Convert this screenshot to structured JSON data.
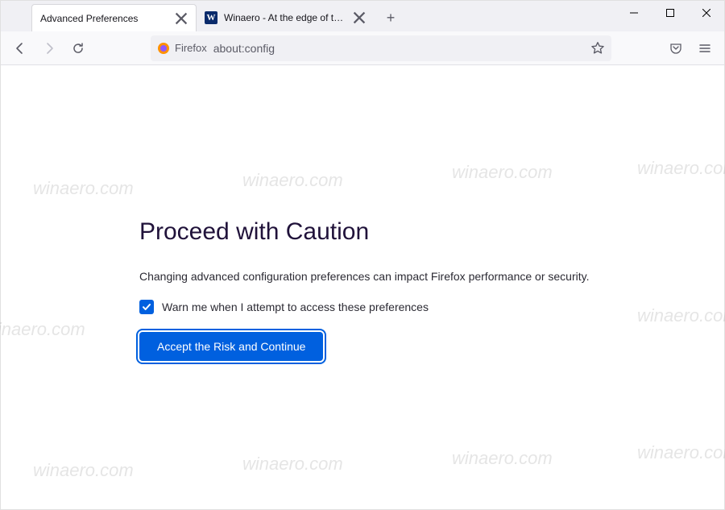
{
  "tabs": [
    {
      "title": "Advanced Preferences",
      "active": true
    },
    {
      "title": "Winaero - At the edge of tweak",
      "active": false,
      "favicon_letter": "W"
    }
  ],
  "urlbar": {
    "identity_label": "Firefox",
    "url": "about:config"
  },
  "warning": {
    "title": "Proceed with Caution",
    "body": "Changing advanced configuration preferences can impact Firefox performance or security.",
    "checkbox_label": "Warn me when I attempt to access these preferences",
    "checkbox_checked": true,
    "accept_label": "Accept the Risk and Continue"
  },
  "watermark": "winaero.com"
}
